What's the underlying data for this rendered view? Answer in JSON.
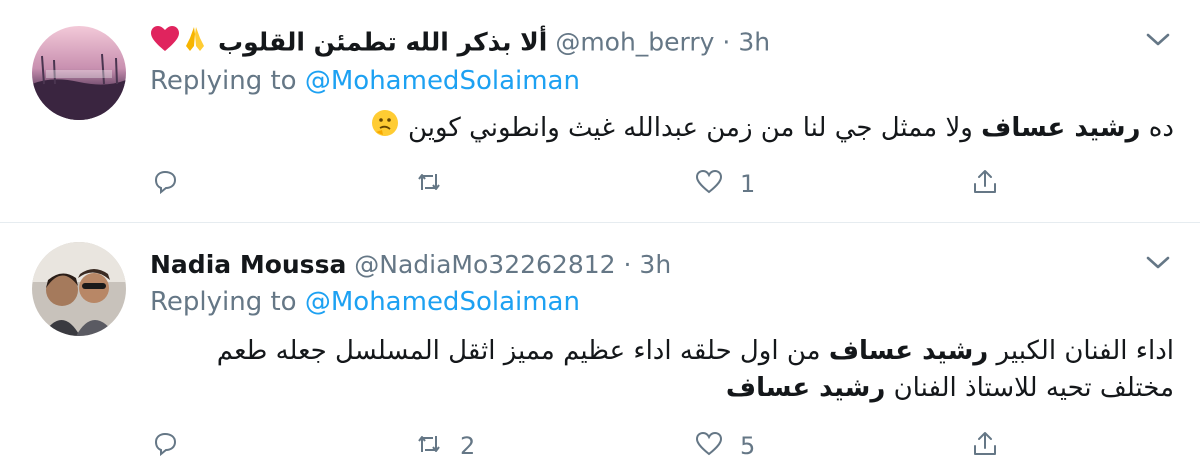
{
  "colors": {
    "accent": "#1da1f2",
    "secondary_text": "#657786",
    "primary_text": "#14171a",
    "divider": "#e6ecf0",
    "heart": "#e0245e"
  },
  "tweets": [
    {
      "display_name": "ألا بذكر الله تطمئن القلوب",
      "display_name_emojis": [
        "folded-hands-icon",
        "red-heart-icon"
      ],
      "handle": "@moh_berry",
      "separator": "·",
      "time": "3h",
      "replying_prefix": "Replying to",
      "replying_to": "@MohamedSolaiman",
      "body_parts": [
        "ده ",
        "رشيد عساف",
        " ولا ممثل جي لنا من زمن عبدالله غيث وانطوني كوين "
      ],
      "body_emoji": "thinking-face-icon",
      "reply_count": "",
      "retweet_count": "",
      "like_count": "1"
    },
    {
      "display_name": "Nadia Moussa",
      "handle": "@NadiaMo32262812",
      "separator": "·",
      "time": "3h",
      "replying_prefix": "Replying to",
      "replying_to": "@MohamedSolaiman",
      "body_parts": [
        "اداء الفنان  الكبير ",
        "رشيد عساف",
        "  من اول حلقه اداء عظيم مميز اثقل المسلسل  جعله طعم مختلف  تحيه للاستاذ الفنان ",
        "رشيد عساف"
      ],
      "reply_count": "",
      "retweet_count": "2",
      "like_count": "5"
    }
  ]
}
